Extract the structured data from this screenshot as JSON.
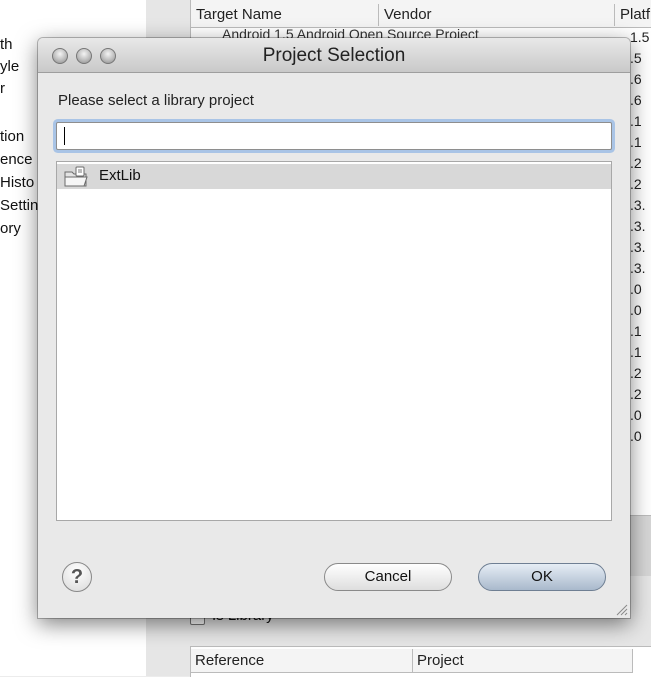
{
  "background_window": {
    "left_items": [
      "th",
      "yle",
      "r",
      "tion",
      "ence",
      "Histo",
      "Settin",
      "ory"
    ],
    "table": {
      "columns": [
        "Target Name",
        "Vendor",
        "Platf"
      ],
      "first_row_fragment": "Android 1.5        Android Open Source Project",
      "platform_versions": [
        "1.5",
        ".5",
        ".6",
        ".6",
        ".1",
        ".1",
        ".2",
        ".2",
        ".3.",
        ".3.",
        ".3.",
        ".3.",
        ".0",
        ".0",
        ".1",
        ".1",
        ".2",
        ".2",
        ".0",
        ".0"
      ]
    },
    "is_library_label": "Is Library",
    "reference_table": {
      "columns": [
        "Reference",
        "Project"
      ]
    }
  },
  "dialog": {
    "title": "Project Selection",
    "prompt": "Please select a library project",
    "filter": {
      "value": "",
      "placeholder": ""
    },
    "projects": [
      {
        "name": "ExtLib",
        "icon": "library-project-icon",
        "selected": true
      }
    ],
    "buttons": {
      "help": "?",
      "cancel": "Cancel",
      "ok": "OK"
    }
  }
}
